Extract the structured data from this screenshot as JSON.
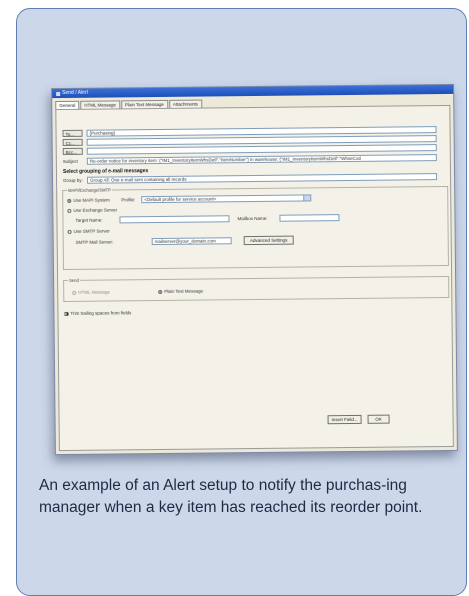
{
  "window": {
    "title": "Send / Alert"
  },
  "tabs": [
    {
      "label": "General"
    },
    {
      "label": "HTML Message"
    },
    {
      "label": "Plain Text Message"
    },
    {
      "label": "Attachments"
    }
  ],
  "address": {
    "to_label": "To...",
    "to_value": "{Purchasing}",
    "cc_label": "Cc...",
    "cc_value": "",
    "bcc_label": "Bcc...",
    "bcc_value": "",
    "subject_label": "Subject",
    "subject_value": "Re-order notice for inventory item: {\"IM1_InventoryItemWhsDetl\".\"ItemNumber\"} in warehouse: {\"IM1_InventoryItemWhsDetl\".\"WhseCod"
  },
  "grouping": {
    "heading": "Select grouping of e-mail messages",
    "group_by_label": "Group by:",
    "group_by_value": "Group All: One e-mail sent containing all records"
  },
  "smtp_group": {
    "title": "MAPI/Exchange/SMTP",
    "use_mapi_label": "Use MAPI System",
    "profile_label": "Profile:",
    "profile_value": "<Default profile for service account>",
    "use_exchange_label": "Use Exchange Server",
    "target_name_label": "Target Name:",
    "target_name_value": "",
    "mailbox_label": "Mailbox Name:",
    "mailbox_value": "",
    "use_smtp_label": "Use SMTP Server",
    "smtp_server_label": "SMTP Mail Server:",
    "smtp_server_value": "mailserver@your_domain.com",
    "advanced_button": "Advanced Settings"
  },
  "send_group": {
    "title": "Send",
    "html_label": "HTML Message",
    "plain_label": "Plain Text Message"
  },
  "options": {
    "trim_label": "Trim trailing spaces from fields"
  },
  "footer": {
    "insert_field_button": "Insert Field...",
    "ok_button": "OK"
  },
  "caption": "An example of an Alert setup to notify the purchas-ing manager when a key item has reached its reorder point."
}
